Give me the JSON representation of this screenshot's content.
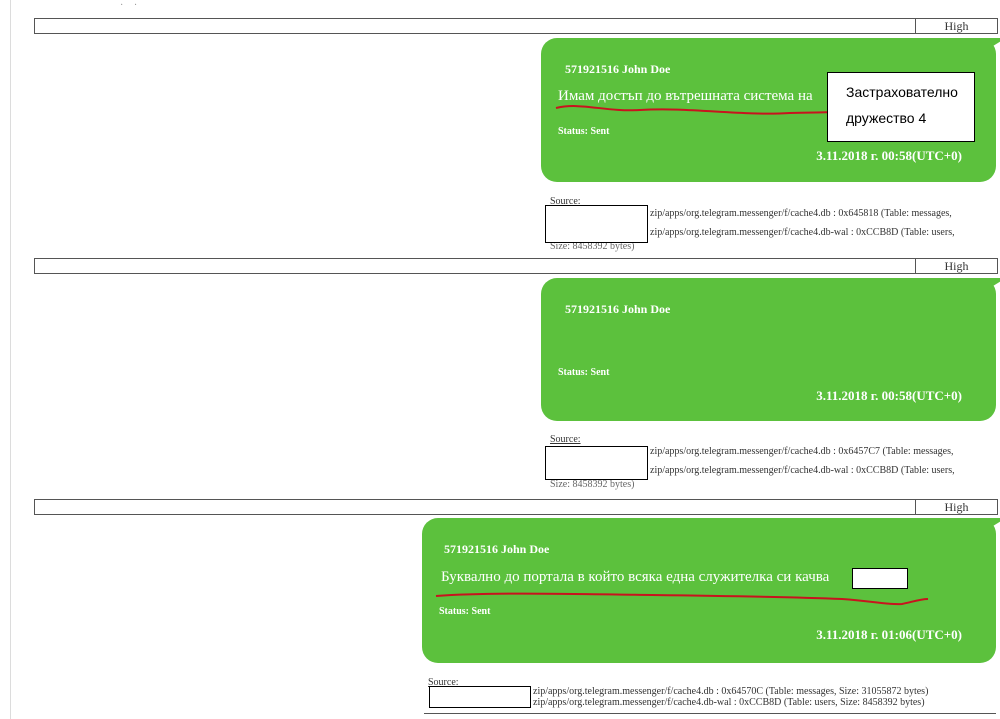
{
  "top_dots": "· ·",
  "messages": [
    {
      "priority": "High",
      "sender": "571921516 John Doe",
      "text": "Имам достъп до вътрешната система на",
      "status_label": "Status:",
      "status_value": "Sent",
      "timestamp": "3.11.2018 г. 00:58(UTC+0)",
      "annotation": [
        "Застрахователно",
        "дружество 4"
      ],
      "source_label": "Source:",
      "source_lines": [
        "zip/apps/org.telegram.messenger/f/cache4.db : 0x645818 (Table: messages,",
        "zip/apps/org.telegram.messenger/f/cache4.db-wal : 0xCCB8D (Table: users,"
      ],
      "source_tail": "Size: 8458392 bytes)"
    },
    {
      "priority": "High",
      "sender": "571921516 John Doe",
      "text": "",
      "status_label": "Status:",
      "status_value": "Sent",
      "timestamp": "3.11.2018 г. 00:58(UTC+0)",
      "source_label": "Source:",
      "source_lines": [
        "zip/apps/org.telegram.messenger/f/cache4.db : 0x6457C7 (Table: messages,",
        "zip/apps/org.telegram.messenger/f/cache4.db-wal : 0xCCB8D (Table: users,"
      ],
      "source_tail": "Size: 8458392 bytes)"
    },
    {
      "priority": "High",
      "sender": "571921516 John Doe",
      "text": "Буквално до портала в който всяка една служителка си качва",
      "status_label": "Status:",
      "status_value": "Sent",
      "timestamp": "3.11.2018 г. 01:06(UTC+0)",
      "source_label": "Source:",
      "source_lines": [
        "zip/apps/org.telegram.messenger/f/cache4.db : 0x64570C (Table: messages, Size: 31055872 bytes)",
        "zip/apps/org.telegram.messenger/f/cache4.db-wal : 0xCCB8D (Table: users, Size: 8458392 bytes)"
      ]
    }
  ]
}
